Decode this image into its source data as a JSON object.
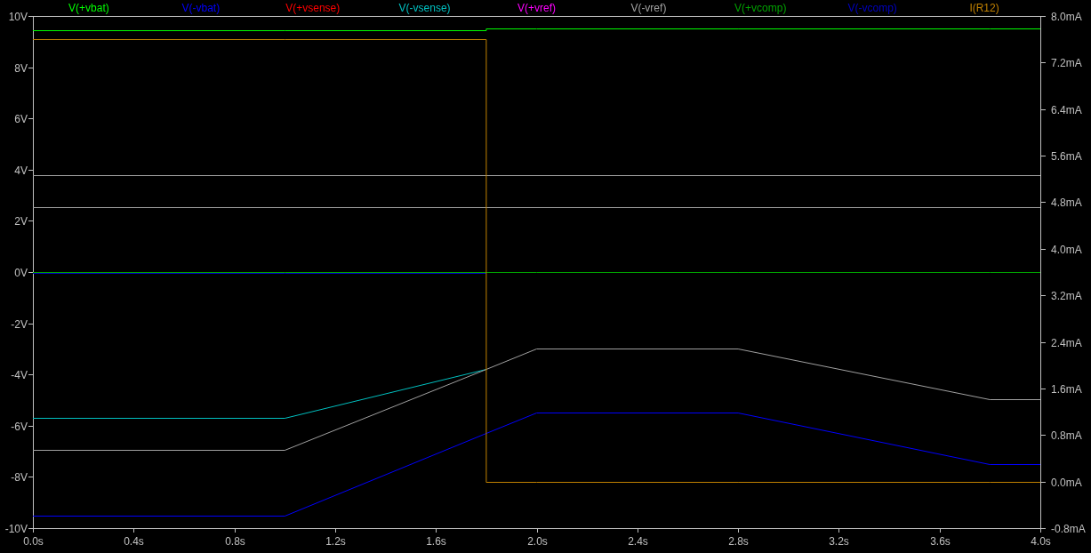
{
  "chart_data": {
    "type": "line",
    "x": [
      0,
      1.0,
      1.8,
      1.8,
      2.0,
      2.8,
      3.8,
      4.0
    ],
    "series": [
      {
        "name": "V(+vbat)",
        "color": "#00ff00",
        "values": [
          9.45,
          9.45,
          9.45,
          9.5,
          9.5,
          9.5,
          9.5,
          9.5
        ]
      },
      {
        "name": "V(-vbat)",
        "color": "#0000ff",
        "values": [
          -9.5,
          -9.5,
          -6.3,
          -6.3,
          -5.5,
          -5.5,
          -7.5,
          -7.5
        ]
      },
      {
        "name": "V(+vsense)",
        "color": "#ff0000",
        "values": [
          null,
          null,
          null,
          null,
          null,
          null,
          null,
          null
        ]
      },
      {
        "name": "V(-vsense)",
        "color": "#00c0c0",
        "values": [
          -5.7,
          -5.7,
          -3.8,
          null,
          null,
          null,
          null,
          null
        ]
      },
      {
        "name": "V(+vref)",
        "color": "#ff00ff",
        "values": [
          null,
          null,
          null,
          null,
          null,
          null,
          null,
          null
        ]
      },
      {
        "name": "V(-vref)",
        "color": "#a0a0a0",
        "values": [
          -6.95,
          -6.95,
          -3.8,
          -3.8,
          -3.0,
          -3.0,
          -4.95,
          -4.95
        ]
      },
      {
        "name": "V(+vcomp)",
        "color": "#00a000",
        "values": [
          0,
          0,
          0,
          0,
          0,
          0,
          0,
          0
        ]
      },
      {
        "name": "V(-vcomp)",
        "color": "#0000c0",
        "values": [
          -0.05,
          -0.05,
          -0.05,
          null,
          null,
          null,
          null,
          null
        ]
      },
      {
        "name": "I(R12)",
        "color": "#c08000",
        "axis": "y2",
        "values": [
          7.6,
          7.6,
          7.6,
          0,
          0,
          0,
          0,
          0
        ]
      }
    ],
    "xlim": [
      0,
      4
    ],
    "ylim": [
      -10,
      10
    ],
    "y2lim": [
      -0.8,
      8.0
    ],
    "xticks": [
      {
        "value": 0,
        "label": "0.0s"
      },
      {
        "value": 0.4,
        "label": "0.4s"
      },
      {
        "value": 0.8,
        "label": "0.8s"
      },
      {
        "value": 1.2,
        "label": "1.2s"
      },
      {
        "value": 1.6,
        "label": "1.6s"
      },
      {
        "value": 2.0,
        "label": "2.0s"
      },
      {
        "value": 2.4,
        "label": "2.4s"
      },
      {
        "value": 2.8,
        "label": "2.8s"
      },
      {
        "value": 3.2,
        "label": "3.2s"
      },
      {
        "value": 3.6,
        "label": "3.6s"
      },
      {
        "value": 4.0,
        "label": "4.0s"
      }
    ],
    "yticks": [
      {
        "value": 10,
        "label": "10V"
      },
      {
        "value": 8,
        "label": "8V"
      },
      {
        "value": 6,
        "label": "6V"
      },
      {
        "value": 4,
        "label": "4V"
      },
      {
        "value": 2,
        "label": "2V"
      },
      {
        "value": 0,
        "label": "0V"
      },
      {
        "value": -2,
        "label": "-2V"
      },
      {
        "value": -4,
        "label": "-4V"
      },
      {
        "value": -6,
        "label": "-6V"
      },
      {
        "value": -8,
        "label": "-8V"
      },
      {
        "value": -10,
        "label": "-10V"
      }
    ],
    "y2ticks": [
      {
        "value": 8.0,
        "label": "8.0mA"
      },
      {
        "value": 7.2,
        "label": "7.2mA"
      },
      {
        "value": 6.4,
        "label": "6.4mA"
      },
      {
        "value": 5.6,
        "label": "5.6mA"
      },
      {
        "value": 4.8,
        "label": "4.8mA"
      },
      {
        "value": 4.0,
        "label": "4.0mA"
      },
      {
        "value": 3.2,
        "label": "3.2mA"
      },
      {
        "value": 2.4,
        "label": "2.4mA"
      },
      {
        "value": 1.6,
        "label": "1.6mA"
      },
      {
        "value": 0.8,
        "label": "0.8mA"
      },
      {
        "value": 0.0,
        "label": "0.0mA"
      },
      {
        "value": -0.8,
        "label": "-0.8mA"
      }
    ],
    "ref_lines": [
      {
        "value": 3.8,
        "axis": "y"
      },
      {
        "value": 2.55,
        "axis": "y"
      }
    ]
  }
}
